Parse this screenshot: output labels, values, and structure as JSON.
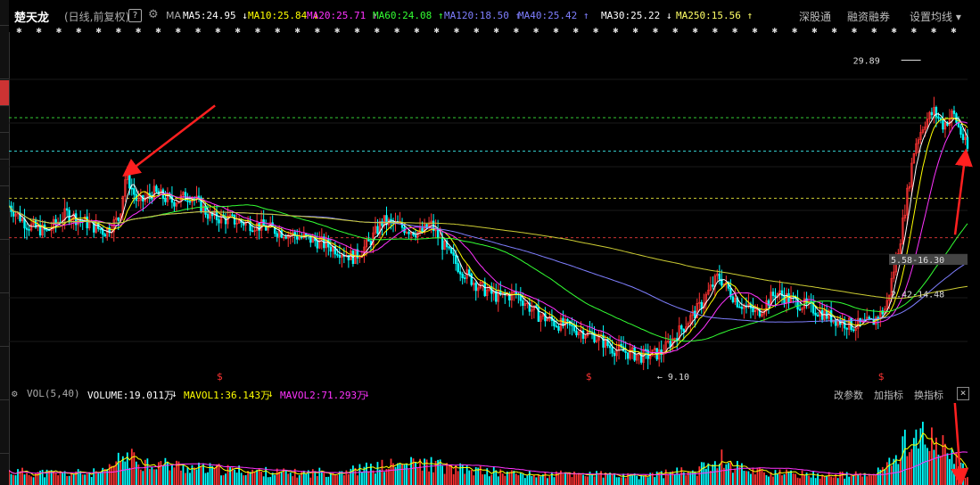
{
  "header": {
    "stock_name": "楚天龙",
    "period": "(日线,前复权)",
    "help": "?",
    "ma_label": "MA",
    "ma_items": [
      {
        "text": "MA5:24.95",
        "arrow": "↓",
        "color": "#ffffff"
      },
      {
        "text": "MA10:25.84",
        "arrow": "↓",
        "color": "#ffff00"
      },
      {
        "text": "MA20:25.71",
        "arrow": "↑",
        "color": "#ff33ff"
      },
      {
        "text": "MA60:24.08",
        "arrow": "↑",
        "color": "#33ff33"
      },
      {
        "text": "MA120:18.50",
        "arrow": "↑",
        "color": "#7f7fff"
      },
      {
        "text": "MA40:25.42",
        "arrow": "↑",
        "color": "#7f7fff"
      },
      {
        "text": "MA30:25.22",
        "arrow": "↓",
        "color": "#ffffff"
      },
      {
        "text": "MA250:15.56",
        "arrow": "↑",
        "color": "#ffff66"
      }
    ],
    "nav": [
      "深股通",
      "融资融券",
      "设置均线 ▾"
    ]
  },
  "volume_header": {
    "label": "VOL(5,40)",
    "volume": "VOLUME:19.011万",
    "volume_arrow": "↓",
    "mavol1": "MAVOL1:36.143万",
    "mavol1_arrow": "↓",
    "mavol2": "MAVOL2:71.293万",
    "mavol2_arrow": "↓",
    "buttons": [
      "改参数",
      "加指标",
      "换指标"
    ],
    "close": "×"
  },
  "colors": {
    "up": "#ff3333",
    "down": "#00ffff",
    "ma5": "#ffffff",
    "ma10": "#ffff00",
    "ma20": "#ff33ff",
    "ma60": "#33ff33",
    "ma120": "#7f7fff",
    "ma250": "#cccc33",
    "arrow": "#ff2020"
  },
  "chart_data": {
    "type": "candlestick",
    "ylim": [
      8.5,
      31.5
    ],
    "annotations": {
      "high_label": "29.89",
      "high_value": 29.89,
      "low_label": "9.10",
      "low_value": 9.1,
      "price_tag_1": "5.58-16.30",
      "price_tag_1_value": 16.3,
      "price_tag_2": "2.42-14.48",
      "price_tag_2_value": 14.5
    },
    "marker_symbol": "$",
    "marker_positions": [
      0.22,
      0.605,
      0.91
    ],
    "reference_lines": [
      {
        "value": 26.1,
        "color": "#33cc33"
      },
      {
        "value": 23.9,
        "color": "#33cccc"
      },
      {
        "value": 20.8,
        "color": "#cccc33"
      },
      {
        "value": 18.2,
        "color": "#cc3333"
      }
    ],
    "arrows": [
      {
        "from": [
          0.215,
          26.9
        ],
        "to": [
          0.122,
          22.4
        ]
      },
      {
        "from": [
          0.987,
          18.4
        ],
        "to": [
          0.998,
          23.8
        ]
      },
      {
        "from": [
          0.984,
          0.38
        ],
        "to": [
          0.993,
          0.04
        ]
      }
    ],
    "price_path": [
      [
        0,
        20.3
      ],
      [
        0.02,
        19.0
      ],
      [
        0.04,
        18.6
      ],
      [
        0.06,
        19.8
      ],
      [
        0.08,
        19.2
      ],
      [
        0.1,
        18.6
      ],
      [
        0.115,
        19.5
      ],
      [
        0.122,
        22.4
      ],
      [
        0.135,
        20.4
      ],
      [
        0.15,
        21.2
      ],
      [
        0.17,
        20.6
      ],
      [
        0.19,
        21.0
      ],
      [
        0.21,
        19.6
      ],
      [
        0.23,
        19.4
      ],
      [
        0.26,
        19.0
      ],
      [
        0.29,
        18.5
      ],
      [
        0.32,
        18.0
      ],
      [
        0.34,
        17.5
      ],
      [
        0.36,
        16.9
      ],
      [
        0.375,
        17.8
      ],
      [
        0.39,
        19.3
      ],
      [
        0.41,
        18.9
      ],
      [
        0.43,
        18.5
      ],
      [
        0.44,
        19.1
      ],
      [
        0.455,
        17.5
      ],
      [
        0.47,
        16.2
      ],
      [
        0.49,
        15.0
      ],
      [
        0.51,
        14.3
      ],
      [
        0.53,
        14.5
      ],
      [
        0.55,
        13.2
      ],
      [
        0.57,
        12.6
      ],
      [
        0.59,
        12.2
      ],
      [
        0.61,
        11.8
      ],
      [
        0.63,
        10.9
      ],
      [
        0.66,
        10.4
      ],
      [
        0.68,
        10.6
      ],
      [
        0.7,
        12.1
      ],
      [
        0.72,
        13.6
      ],
      [
        0.74,
        15.7
      ],
      [
        0.76,
        14.0
      ],
      [
        0.78,
        13.2
      ],
      [
        0.8,
        14.6
      ],
      [
        0.82,
        14.0
      ],
      [
        0.84,
        13.5
      ],
      [
        0.86,
        12.9
      ],
      [
        0.88,
        12.4
      ],
      [
        0.9,
        12.6
      ],
      [
        0.915,
        13.6
      ],
      [
        0.93,
        18.2
      ],
      [
        0.945,
        24.3
      ],
      [
        0.955,
        25.8
      ],
      [
        0.965,
        26.5
      ],
      [
        0.975,
        25.6
      ],
      [
        0.985,
        26.4
      ],
      [
        1.0,
        24.0
      ]
    ],
    "volume_path": [
      [
        0,
        0.16
      ],
      [
        0.05,
        0.14
      ],
      [
        0.1,
        0.15
      ],
      [
        0.12,
        0.35
      ],
      [
        0.14,
        0.28
      ],
      [
        0.2,
        0.2
      ],
      [
        0.3,
        0.14
      ],
      [
        0.36,
        0.18
      ],
      [
        0.4,
        0.24
      ],
      [
        0.44,
        0.26
      ],
      [
        0.46,
        0.2
      ],
      [
        0.55,
        0.12
      ],
      [
        0.6,
        0.14
      ],
      [
        0.65,
        0.1
      ],
      [
        0.72,
        0.18
      ],
      [
        0.74,
        0.34
      ],
      [
        0.76,
        0.22
      ],
      [
        0.8,
        0.14
      ],
      [
        0.86,
        0.12
      ],
      [
        0.9,
        0.12
      ],
      [
        0.92,
        0.26
      ],
      [
        0.94,
        0.6
      ],
      [
        0.96,
        0.55
      ],
      [
        0.97,
        0.45
      ],
      [
        0.985,
        0.4
      ],
      [
        1.0,
        0.1
      ]
    ]
  }
}
